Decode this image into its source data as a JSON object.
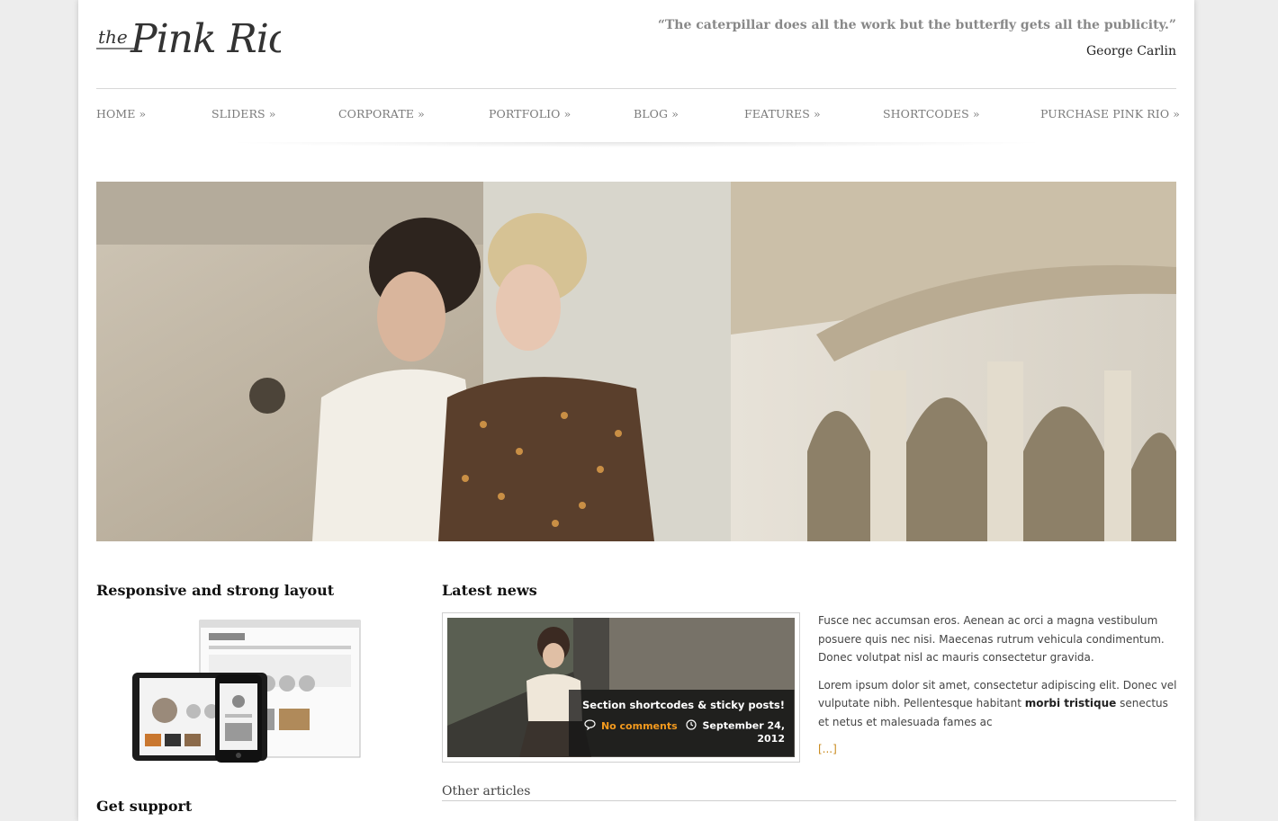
{
  "logo": {
    "the": "the",
    "name": "Pink Rio"
  },
  "header": {
    "quote": "“The caterpillar does all the work but the butterfly gets all the publicity.”",
    "author": "George Carlin"
  },
  "nav": {
    "items": [
      {
        "label": "HOME »"
      },
      {
        "label": "SLIDERS »"
      },
      {
        "label": "CORPORATE »"
      },
      {
        "label": "PORTFOLIO »"
      },
      {
        "label": "BLOG »"
      },
      {
        "label": "FEATURES »"
      },
      {
        "label": "SHORTCODES »"
      },
      {
        "label": "PURCHASE PINK RIO »"
      }
    ]
  },
  "left": {
    "layout_title": "Responsive and strong layout",
    "support_title": "Get support"
  },
  "news": {
    "title": "Latest news",
    "post_title": "Section shortcodes & sticky posts!",
    "comments": "No comments",
    "date": "September 24, 2012",
    "para1": "Fusce nec accumsan eros. Aenean ac orci a magna vestibulum posuere quis nec nisi. Maecenas rutrum vehicula condimentum. Donec volutpat nisl ac mauris consectetur gravida.",
    "para2_start": "Lorem ipsum dolor sit amet, consectetur adipiscing elit. Donec vel vulputate nibh. Pellentesque habitant ",
    "para2_bold": "morbi tristique",
    "para2_end": " senectus et netus et malesuada fames ac",
    "more": "[...]",
    "other_title": "Other articles"
  },
  "colors": {
    "accent": "#f39a1e",
    "nav": "#7a7a7a",
    "quote": "#888888"
  },
  "icons": [
    "comment-icon",
    "clock-icon"
  ]
}
